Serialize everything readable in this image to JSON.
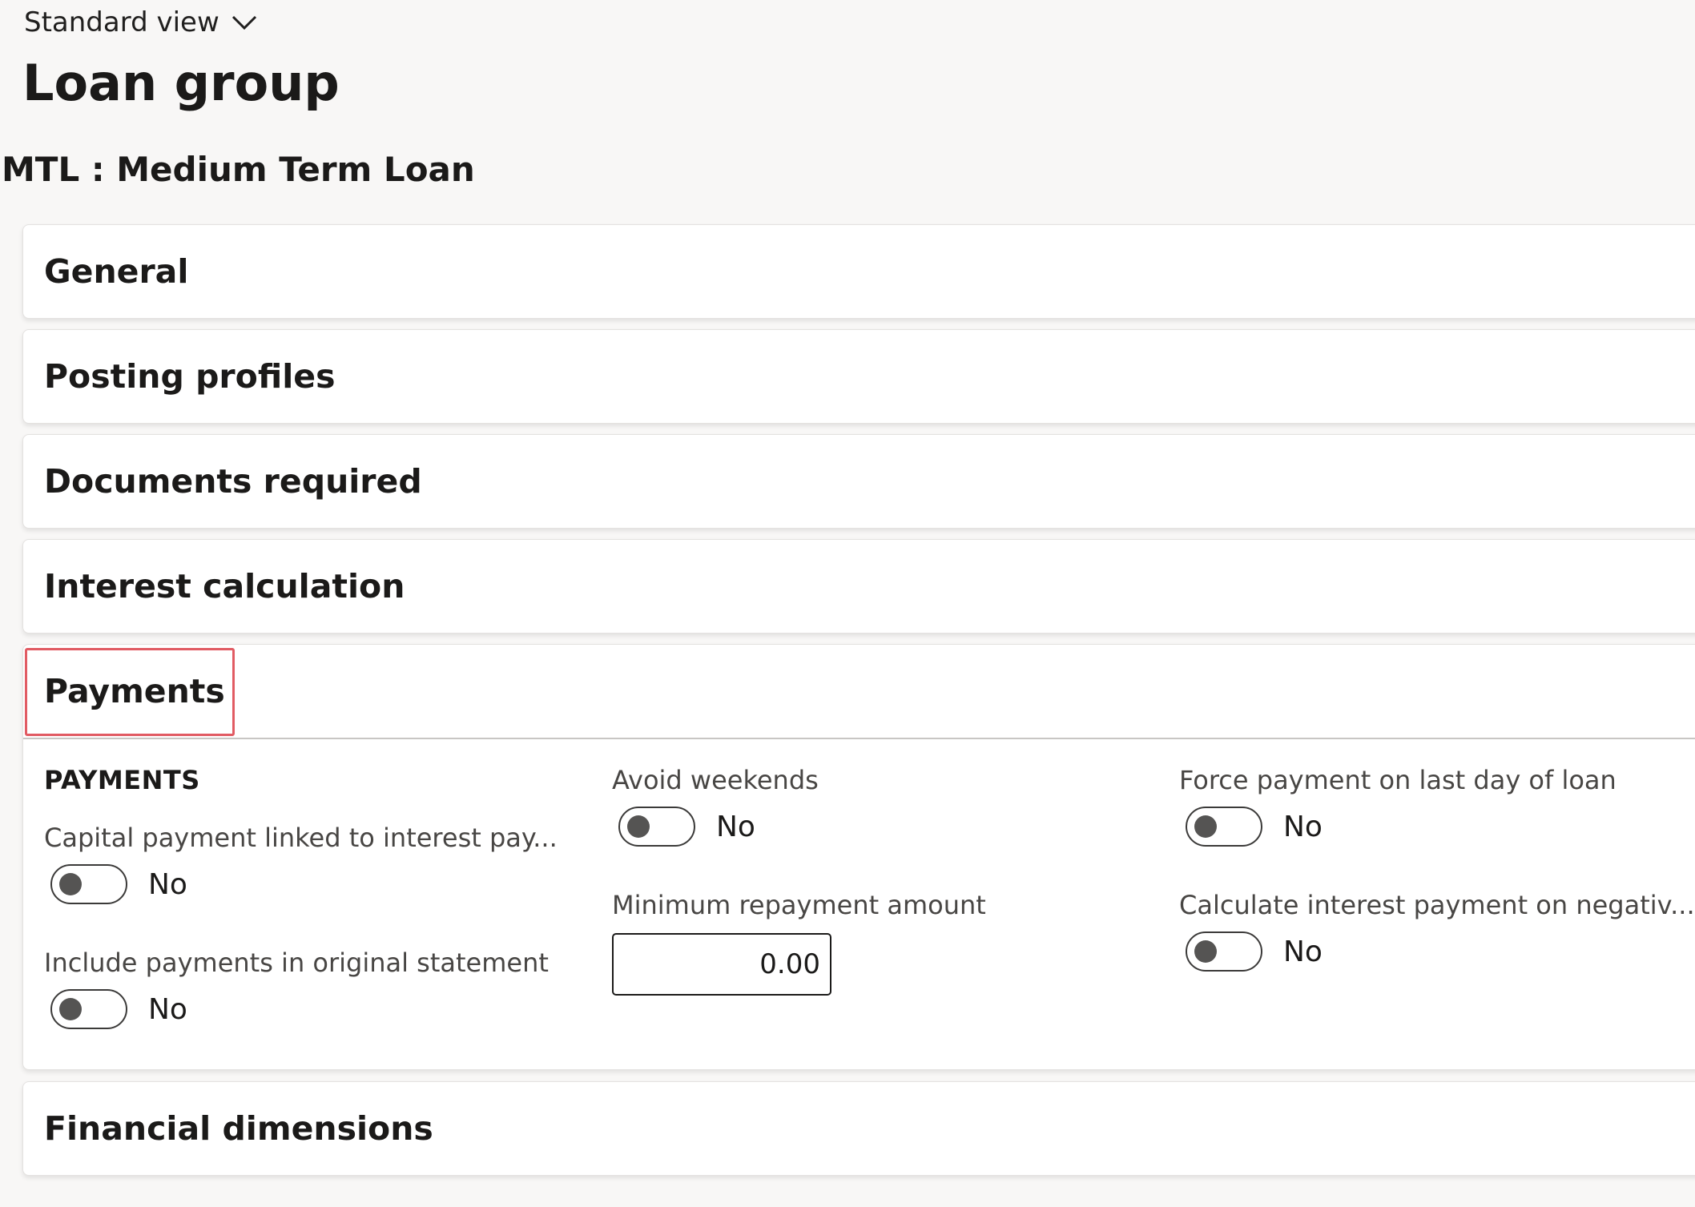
{
  "view": {
    "label": "Standard view"
  },
  "page": {
    "title": "Loan group",
    "caption": "MTL : Medium Term Loan"
  },
  "tabs": {
    "general": "General",
    "posting_profiles": "Posting profiles",
    "documents_required": "Documents required",
    "interest_calculation": "Interest calculation",
    "payments": "Payments",
    "financial_dimensions": "Financial dimensions"
  },
  "payments": {
    "group_caption": "PAYMENTS",
    "capital_payment_linked": {
      "label": "Capital payment linked to interest pay...",
      "value": "No"
    },
    "include_payments_original": {
      "label": "Include payments in original statement",
      "value": "No"
    },
    "avoid_weekends": {
      "label": "Avoid weekends",
      "value": "No"
    },
    "minimum_repayment": {
      "label": "Minimum repayment amount",
      "value": "0.00"
    },
    "force_payment_last_day": {
      "label": "Force payment on last day of loan",
      "value": "No"
    },
    "calculate_interest_negative": {
      "label": "Calculate interest payment on negativ...",
      "value": "No"
    }
  },
  "colors": {
    "highlight": "#e15b63",
    "toggle_knob": "#555453",
    "background": "#f8f7f6"
  },
  "icons": {
    "view_dropdown": "chevron-down-icon"
  }
}
